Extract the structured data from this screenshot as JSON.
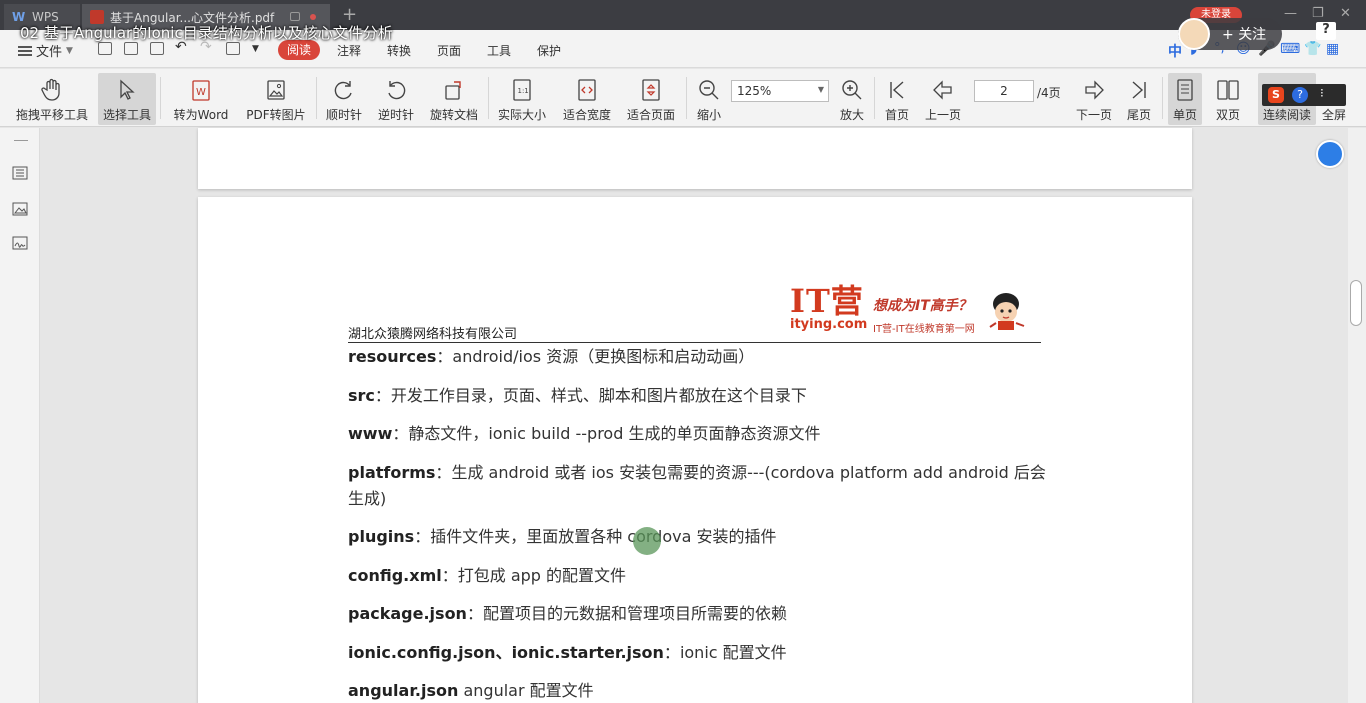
{
  "video_overlay_title": "02 基于Angular的Ionic目录结构分析以及核心文件分析",
  "titlebar": {
    "tabs": [
      {
        "label": "WPS",
        "icon": "wps-logo-icon"
      },
      {
        "label": "基于Angular...心文件分析.pdf",
        "icon": "pdf-file-icon"
      }
    ],
    "login_label": "未登录"
  },
  "overlay": {
    "follow_label": "关注",
    "help_label": "?"
  },
  "menubar": {
    "file_label": "文件",
    "items": [
      "阅读",
      "注释",
      "转换",
      "页面",
      "工具",
      "保护"
    ],
    "active_item": "阅读",
    "ime_label": "中"
  },
  "toolbar": {
    "hand_tool": "拖拽平移工具",
    "select_tool": "选择工具",
    "to_word": "转为Word",
    "pdf_to_image": "PDF转图片",
    "rotate_cw": "顺时针",
    "rotate_ccw": "逆时针",
    "rotate_doc": "旋转文档",
    "actual_size": "实际大小",
    "fit_width": "适合宽度",
    "fit_page": "适合页面",
    "zoom_out": "缩小",
    "zoom_value": "125%",
    "zoom_in": "放大",
    "first_page": "首页",
    "prev_page": "上一页",
    "current_page": "2",
    "total_pages": "/4页",
    "next_page": "下一页",
    "last_page": "尾页",
    "single_page": "单页",
    "double_page": "双页",
    "continuous": "连续阅读",
    "fullscreen": "全屏"
  },
  "document": {
    "company": "湖北众猿腾网络科技有限公司",
    "logo": {
      "brand": "IT营",
      "url": "itying.com",
      "slogan": "想成为IT高手？",
      "subtitle": "IT营-IT在线教育第一网"
    },
    "paragraphs": [
      {
        "term": "resources",
        "sep": "：",
        "text": "android/ios 资源（更换图标和启动动画）"
      },
      {
        "term": "src",
        "sep": "：",
        "text": "开发工作目录，页面、样式、脚本和图片都放在这个目录下"
      },
      {
        "term": "www",
        "sep": "：",
        "text": "静态文件，ionic build --prod 生成的单页面静态资源文件"
      },
      {
        "term": "platforms",
        "sep": "：",
        "text": "生成 android 或者 ios 安装包需要的资源---(cordova platform add android 后会生成)"
      },
      {
        "term": "plugins",
        "sep": "：",
        "text": "插件文件夹，里面放置各种 cordova 安装的插件"
      },
      {
        "term": "config.xml",
        "sep": "：",
        "text": "打包成 app 的配置文件"
      },
      {
        "term": "package.json",
        "sep": "：",
        "text": "配置项目的元数据和管理项目所需要的依赖"
      },
      {
        "term": "ionic.config.json、ionic.starter.json",
        "sep": "：",
        "text": "ionic 配置文件"
      },
      {
        "term": "angular.json",
        "sep": " ",
        "text": "angular 配置文件"
      }
    ]
  }
}
